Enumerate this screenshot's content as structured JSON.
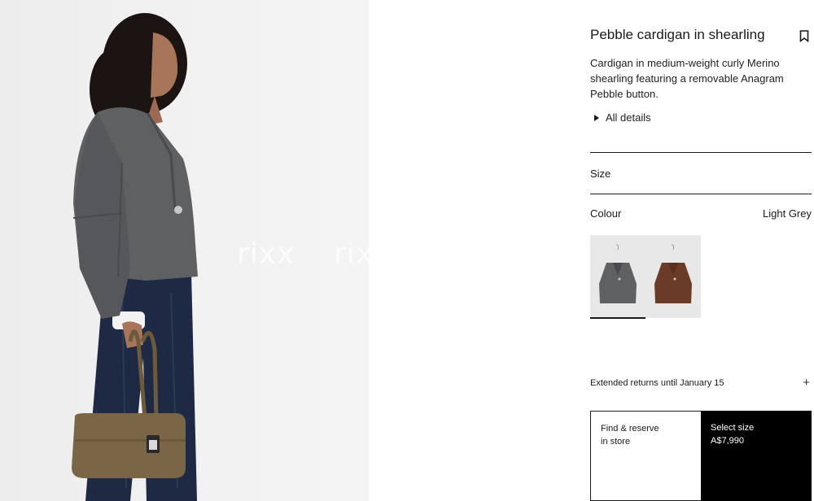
{
  "hero": {
    "image_alt": "Model wearing grey shearling cardigan holding brown bag",
    "watermark": [
      "rixx",
      "rixx"
    ]
  },
  "product": {
    "title": "Pebble cardigan in shearling",
    "description": "Cardigan in medium-weight curly Merino shearling featuring a removable Anagram Pebble button.",
    "details_label": "All details",
    "bookmark_icon": "bookmark-icon"
  },
  "size": {
    "label": "Size"
  },
  "colour": {
    "label": "Colour",
    "selected": "Light Grey",
    "swatches": [
      {
        "name": "Light Grey",
        "color": "#5f6062",
        "active": true
      },
      {
        "name": "Brown",
        "color": "#6a3b26",
        "active": false
      }
    ]
  },
  "returns": {
    "label": "Extended returns until January 15",
    "icon": "plus-icon"
  },
  "buy": {
    "find_line1": "Find & reserve",
    "find_line2": "in store",
    "select_label": "Select size",
    "price": "A$7,990"
  },
  "colors": {
    "text": "#1a1a1a",
    "button_bg": "#000000",
    "button_text": "#ffffff"
  }
}
